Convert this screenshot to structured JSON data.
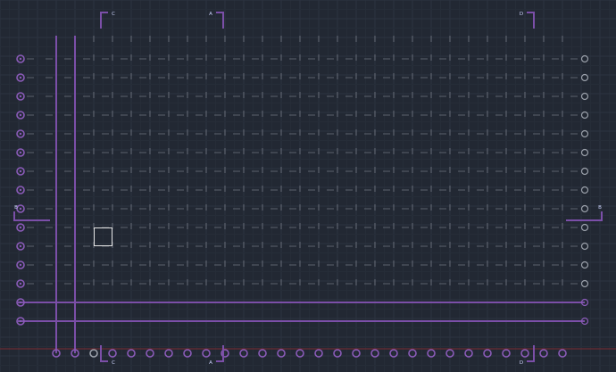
{
  "app": {
    "kind": "cad-drawing-viewport"
  },
  "colors": {
    "background": "#222833",
    "grid_major": "#2c3340",
    "grid_minor": "#262d38",
    "tick_marks": "#b4b9c2",
    "axis_lines": "#7b4fa8",
    "bubbles": "#8a5bb8",
    "bubbles_grey": "#9aa0aa",
    "section_markers": "#7b4fa8",
    "section_text": "#cfd6ff",
    "selection_box": "#e6e6e6",
    "accent_red": "#7a2a30"
  },
  "section_markers": [
    {
      "id": "C-top",
      "label": "C"
    },
    {
      "id": "A-top",
      "label": "A"
    },
    {
      "id": "D-top",
      "label": "D"
    },
    {
      "id": "B-left",
      "label": "B"
    },
    {
      "id": "B-right",
      "label": "B"
    },
    {
      "id": "C-bottom",
      "label": "C"
    },
    {
      "id": "A-bottom",
      "label": "A"
    },
    {
      "id": "D-bottom",
      "label": "D"
    }
  ],
  "grid": {
    "columns": 28,
    "rows": 15
  },
  "selection": {
    "visible": true
  }
}
